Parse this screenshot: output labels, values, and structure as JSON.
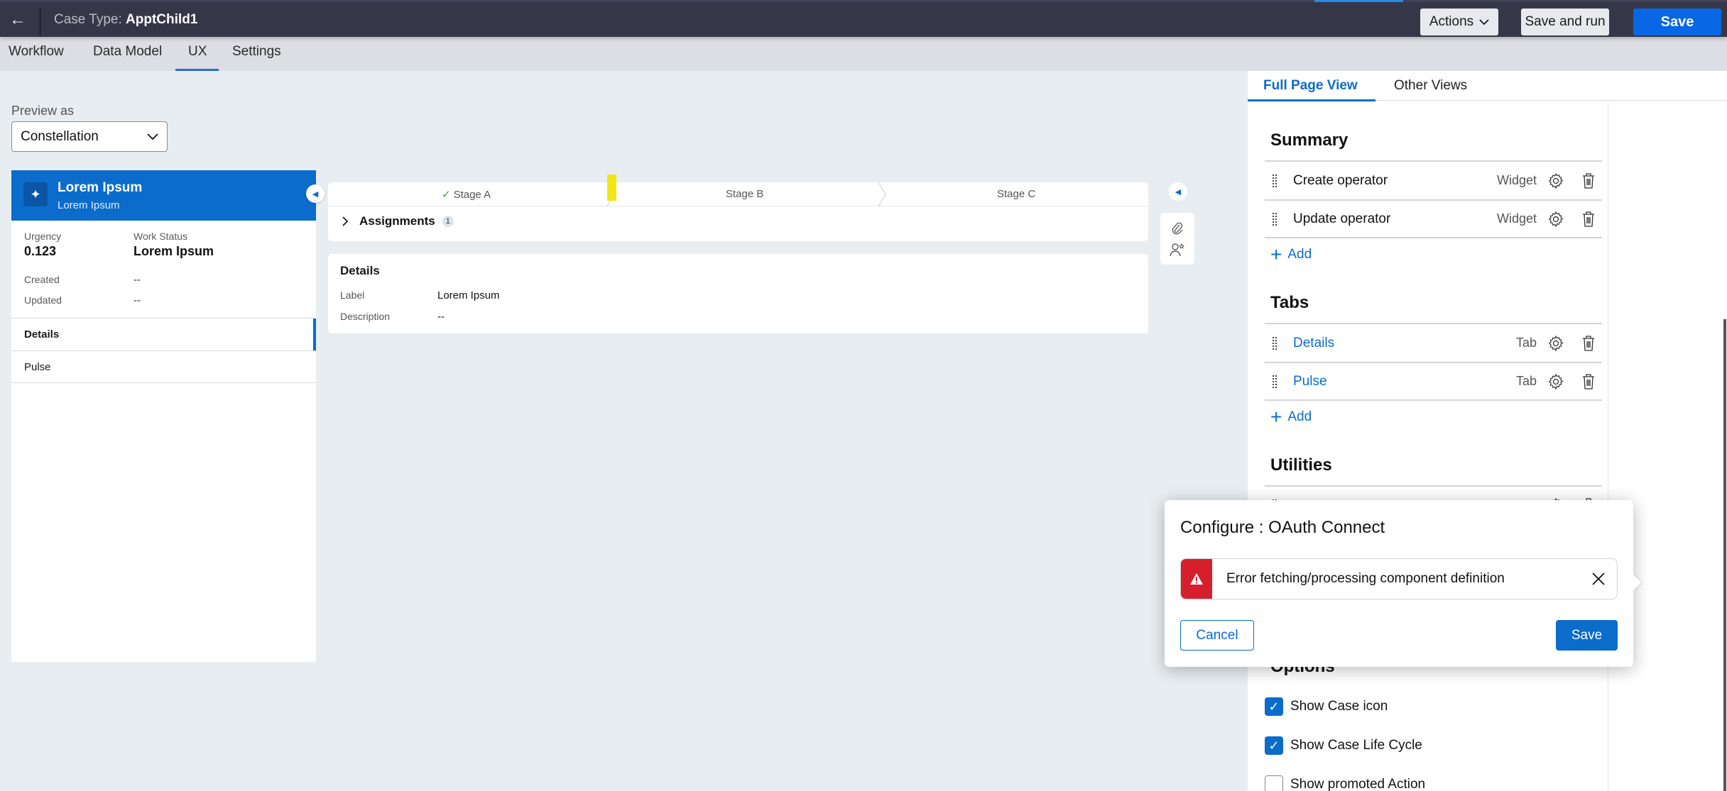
{
  "appbar": {
    "title_prefix": "Case Type:",
    "title_name": "ApptChild1",
    "actions_label": "Actions",
    "save_and_run_label": "Save and run",
    "save_label": "Save"
  },
  "tabs": [
    {
      "label": "Workflow"
    },
    {
      "label": "Data Model"
    },
    {
      "label": "UX",
      "active": true
    },
    {
      "label": "Settings"
    }
  ],
  "preview": {
    "label": "Preview as",
    "selected": "Constellation"
  },
  "case_card": {
    "name": "Lorem Ipsum",
    "subtitle": "Lorem Ipsum",
    "fields": {
      "urgency_label": "Urgency",
      "urgency_value": "0.123",
      "work_status_label": "Work Status",
      "work_status_value": "Lorem Ipsum",
      "created_label": "Created",
      "created_value": "--",
      "updated_label": "Updated",
      "updated_value": "--"
    },
    "tabs": [
      {
        "label": "Details",
        "selected": true
      },
      {
        "label": "Pulse"
      }
    ]
  },
  "stages": [
    {
      "label": "Stage A",
      "completed": true
    },
    {
      "label": "Stage B"
    },
    {
      "label": "Stage C"
    }
  ],
  "assignments": {
    "label": "Assignments",
    "count": "1"
  },
  "details_card": {
    "heading": "Details",
    "label_label": "Label",
    "label_value": "Lorem Ipsum",
    "description_label": "Description",
    "description_value": "--"
  },
  "right_panel": {
    "tabs": [
      {
        "label": "Full Page View",
        "active": true
      },
      {
        "label": "Other Views"
      }
    ],
    "summary": {
      "heading": "Summary",
      "items": [
        {
          "label": "Create operator",
          "type": "Widget"
        },
        {
          "label": "Update operator",
          "type": "Widget"
        }
      ],
      "add_label": "Add"
    },
    "tabs_section": {
      "heading": "Tabs",
      "items": [
        {
          "label": "Details",
          "type": "Tab"
        },
        {
          "label": "Pulse",
          "type": "Tab"
        }
      ],
      "add_label": "Add"
    },
    "utilities": {
      "heading": "Utilities"
    },
    "options": {
      "heading": "Options",
      "items": [
        {
          "label": "Show Case icon",
          "checked": true
        },
        {
          "label": "Show Case Life Cycle",
          "checked": true
        },
        {
          "label": "Show promoted Action",
          "checked": false
        }
      ]
    }
  },
  "popover": {
    "title": "Configure : OAuth Connect",
    "error_message": "Error fetching/processing component definition",
    "cancel_label": "Cancel",
    "save_label": "Save"
  },
  "colors": {
    "brand_blue": "#0b6ccc",
    "primary_save": "#0767e4",
    "appbar": "#353748",
    "error_red": "#d61f2c",
    "check_green": "#2aa64a",
    "highlight_yellow": "#f0e60a"
  }
}
